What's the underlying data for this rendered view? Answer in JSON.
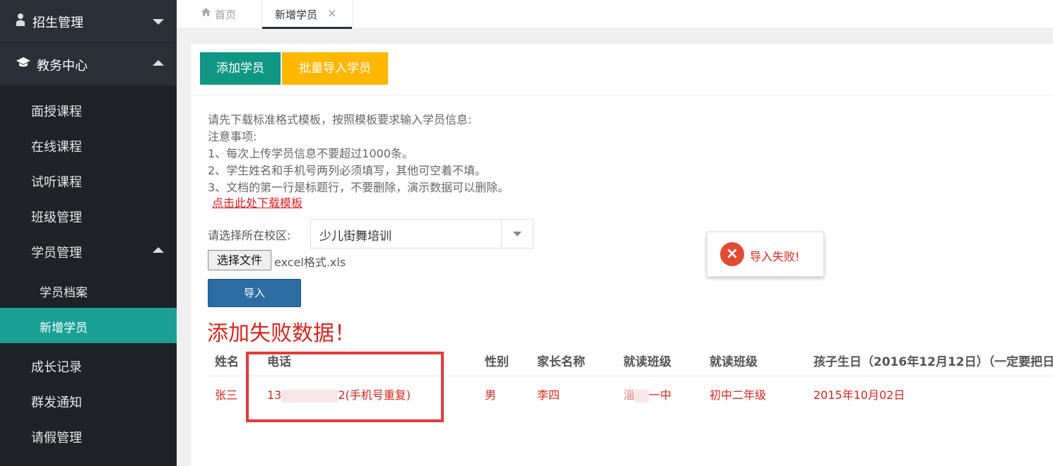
{
  "sidebar": {
    "groups": [
      {
        "label": "招生管理"
      },
      {
        "label": "教务中心"
      }
    ],
    "items": [
      {
        "label": "面授课程"
      },
      {
        "label": "在线课程"
      },
      {
        "label": "试听课程"
      },
      {
        "label": "班级管理"
      },
      {
        "label": "学员管理"
      },
      {
        "label": "学员档案"
      },
      {
        "label": "新增学员"
      },
      {
        "label": "成长记录"
      },
      {
        "label": "群发通知"
      },
      {
        "label": "请假管理"
      }
    ]
  },
  "tabs": {
    "home": "首页",
    "current": "新增学员",
    "close": "×"
  },
  "toolbar": {
    "add": "添加学员",
    "batch": "批量导入学员"
  },
  "instructions": {
    "lines": [
      "请先下载标准格式模板，按照模板要求输入学员信息:",
      "注意事项:",
      "1、每次上传学员信息不要超过1000条。",
      "2、学生姓名和手机号两列必须填写，其他可空着不填。",
      "3、文档的第一行是标题行，不要删除，演示数据可以删除。"
    ],
    "download_link": "点击此处下载模板"
  },
  "form": {
    "campus_label": "请选择所在校区:",
    "campus_value": "少儿街舞培训",
    "file_button": "选择文件",
    "file_name": "excel格式.xls",
    "import_button": "导入"
  },
  "fail_title": "添加失败数据！",
  "table": {
    "headers": [
      "姓名",
      "电话",
      "性别",
      "家长名称",
      "就读班级",
      "就读班级",
      "孩子生日（2016年12月12日）（一定要把日"
    ],
    "rows": [
      {
        "name": "张三",
        "phone_prefix": "13",
        "phone_suffix": "2(手机号重复)",
        "gender": "男",
        "parent": "李四",
        "school_prefix": "淄",
        "school_suffix": "一中",
        "class": "初中二年级",
        "birthday": "2015年10月02日"
      }
    ]
  },
  "toast": {
    "icon": "×",
    "message": "导入失败!"
  },
  "colors": {
    "sidebar_bg": "#1f2226",
    "accent_teal": "#1aa094",
    "button_green": "#109685",
    "button_yellow": "#ffb800",
    "import_blue": "#2e6da4",
    "error_red": "#d9251d"
  }
}
